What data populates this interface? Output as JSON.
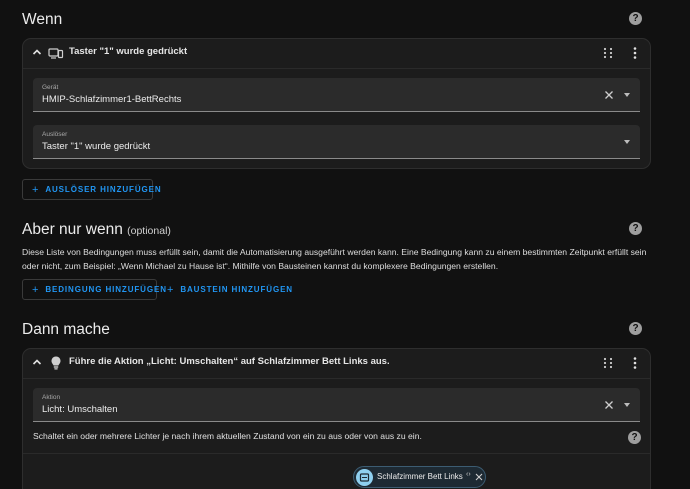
{
  "triggers": {
    "title": "Wenn",
    "card": {
      "header": "Taster \"1\" wurde gedrückt",
      "device_field": {
        "label": "Gerät",
        "value": "HMIP-Schlafzimmer1-BettRechts"
      },
      "trigger_field": {
        "label": "Auslöser",
        "value": "Taster \"1\" wurde gedrückt"
      }
    },
    "add_button": "AUSLÖSER HINZUFÜGEN"
  },
  "conditions": {
    "title": "Aber nur wenn",
    "optional": "(optional)",
    "description": "Diese Liste von Bedingungen muss erfüllt sein, damit die Automatisierung ausgeführt werden kann. Eine Bedingung kann zu einem bestimmten Zeitpunkt erfüllt sein oder nicht, zum Beispiel: „Wenn Michael zu Hause ist“. Mithilfe von Bausteinen kannst du komplexere Bedingungen erstellen.",
    "add_condition_button": "BEDINGUNG HINZUFÜGEN",
    "add_block_button": "BAUSTEIN HINZUFÜGEN"
  },
  "actions": {
    "title": "Dann mache",
    "card": {
      "header": "Führe die Aktion „Licht: Umschalten“ auf Schlafzimmer Bett Links aus.",
      "action_field": {
        "label": "Aktion",
        "value": "Licht: Umschalten"
      },
      "description": "Schaltet ein oder mehrere Lichter je nach ihrem aktuellen Zustand von ein zu aus oder von aus zu ein.",
      "target_chip": {
        "label": "Schlafzimmer Bett Links",
        "code": "‹›"
      }
    }
  },
  "plus_symbol": "+",
  "help_symbol": "?",
  "icons": [
    "help-icon",
    "chevron-up-icon",
    "device-icon",
    "drag-handle-icon",
    "more-vertical-icon",
    "clear-icon",
    "dropdown-arrow-icon",
    "plus-icon",
    "lightbulb-icon",
    "entity-icon",
    "close-icon"
  ],
  "colors": {
    "accent": "#2196f3",
    "background": "#111111",
    "card": "#1c1c1c",
    "field": "#2b2b2b"
  }
}
